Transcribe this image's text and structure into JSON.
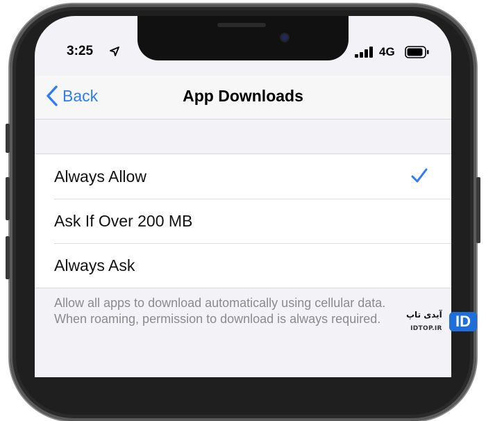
{
  "status_bar": {
    "time": "3:25",
    "network": "4G"
  },
  "nav": {
    "back_label": "Back",
    "title": "App Downloads"
  },
  "options": [
    {
      "label": "Always Allow",
      "selected": true
    },
    {
      "label": "Ask If Over 200 MB",
      "selected": false
    },
    {
      "label": "Always Ask",
      "selected": false
    }
  ],
  "footer": {
    "line1": "Allow all apps to download automatically using cellular data.",
    "line2": "When roaming, permission to download is always required."
  },
  "watermark": {
    "persian": "آیدی تاپ",
    "domain": "IDTOP.IR",
    "logo": "ID"
  },
  "colors": {
    "accent": "#2f7cf6",
    "background": "#f2f2f7"
  },
  "icons": [
    "location-arrow-icon",
    "cellular-signal-icon",
    "battery-icon",
    "chevron-left-icon",
    "checkmark-icon"
  ]
}
